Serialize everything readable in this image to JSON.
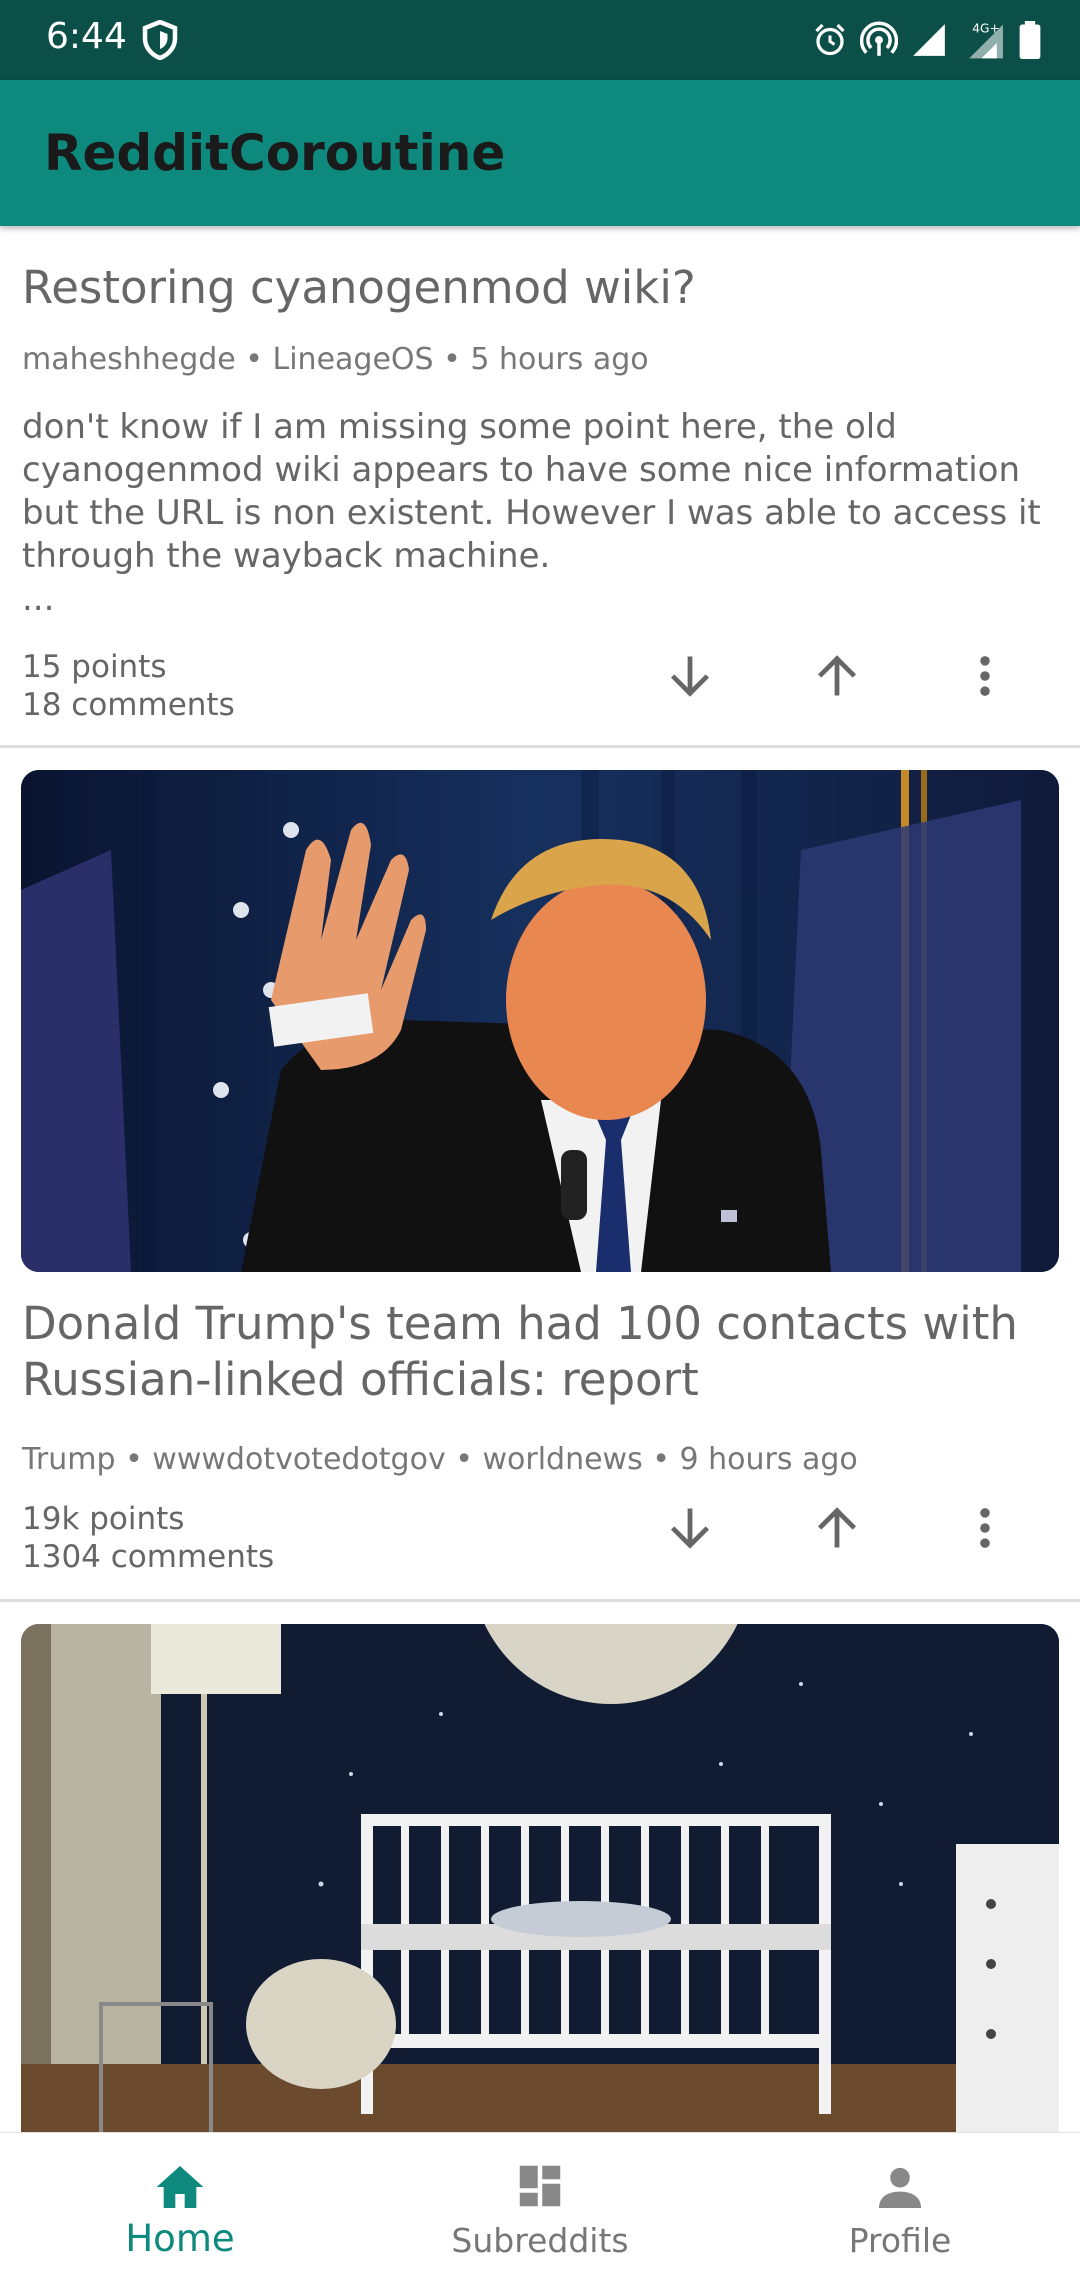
{
  "status_bar": {
    "time": "6:44",
    "network": "4G+"
  },
  "app_bar": {
    "title": "RedditCoroutine"
  },
  "posts": [
    {
      "title": "Restoring cyanogenmod wiki?",
      "meta": "maheshhegde • LineageOS • 5 hours ago",
      "body": "don't know if I am missing some point here, the old cyanogenmod wiki appears to have some nice information but the URL is non existent. However I was able to access it through the wayback machine.",
      "ellipsis": "...",
      "points": "15 points",
      "comments": "18 comments"
    },
    {
      "title": "Donald Trump's team had 100 contacts with Russian-linked officials: report",
      "meta": "Trump • wwwdotvotedotgov • worldnews • 9 hours ago",
      "points": "19k points",
      "comments": "1304 comments"
    }
  ],
  "bottom_nav": {
    "items": [
      {
        "label": "Home",
        "icon": "home-icon",
        "active": true
      },
      {
        "label": "Subreddits",
        "icon": "dashboard-icon",
        "active": false
      },
      {
        "label": "Profile",
        "icon": "person-icon",
        "active": false
      }
    ]
  },
  "colors": {
    "primary": "#0d8a7d",
    "primary_dark": "#0c4f48",
    "divider": "#dddddd"
  }
}
